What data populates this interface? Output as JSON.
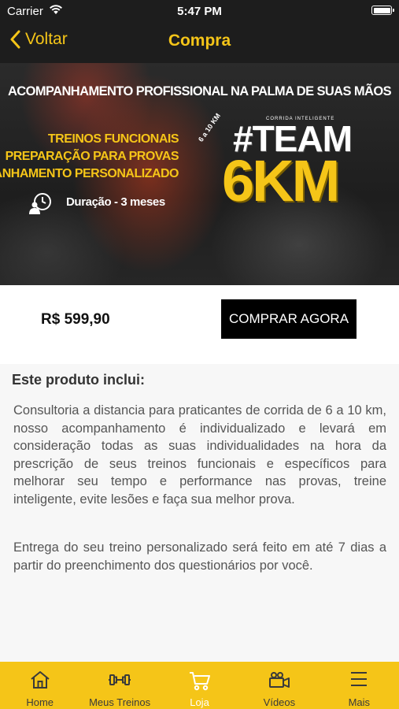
{
  "status_bar": {
    "carrier": "Carrier",
    "time": "5:47 PM"
  },
  "nav": {
    "back_label": "Voltar",
    "title": "Compra"
  },
  "banner": {
    "headline": "ACOMPANHAMENTO PROFISSIONAL NA PALMA DE SUAS MÃOS",
    "features": [
      "TREINOS FUNCIONAIS",
      "PREPARAÇÃO PARA PROVAS",
      "ACOMPANHAMENTO PERSONALIZADO"
    ],
    "distance": "6 a 10 KM",
    "duration": "Duração - 3 meses",
    "tagline": "CORRIDA INTELIGENTE",
    "brand_line1": "#TEAM",
    "brand_line2": "6KM"
  },
  "purchase": {
    "price": "R$ 599,90",
    "buy_label": "COMPRAR AGORA"
  },
  "details": {
    "heading": "Este produto inclui:",
    "paragraphs": [
      "Consultoria a distancia para praticantes de corrida de 6 a 10 km, nosso acompanhamento é individualizado e levará em consideração  todas as suas individualidades na hora da prescrição de seus treinos funcionais e específicos para melhorar seu tempo e performance nas provas, treine inteligente, evite lesões e faça sua melhor prova.",
      "Entrega do seu treino personalizado será feito em até 7 dias a partir do preenchimento dos questionários por você."
    ]
  },
  "tabs": [
    {
      "label": "Home",
      "icon": "home-icon"
    },
    {
      "label": "Meus Treinos",
      "icon": "dumbbell-icon"
    },
    {
      "label": "Loja",
      "icon": "cart-icon",
      "active": true
    },
    {
      "label": "Vídeos",
      "icon": "video-camera-icon"
    },
    {
      "label": "Mais",
      "icon": "menu-icon"
    }
  ],
  "colors": {
    "accent": "#f5c518",
    "nav_background": "#1d1d1d",
    "active_tab": "#ffffff",
    "tab_text": "#3a3a3a"
  }
}
